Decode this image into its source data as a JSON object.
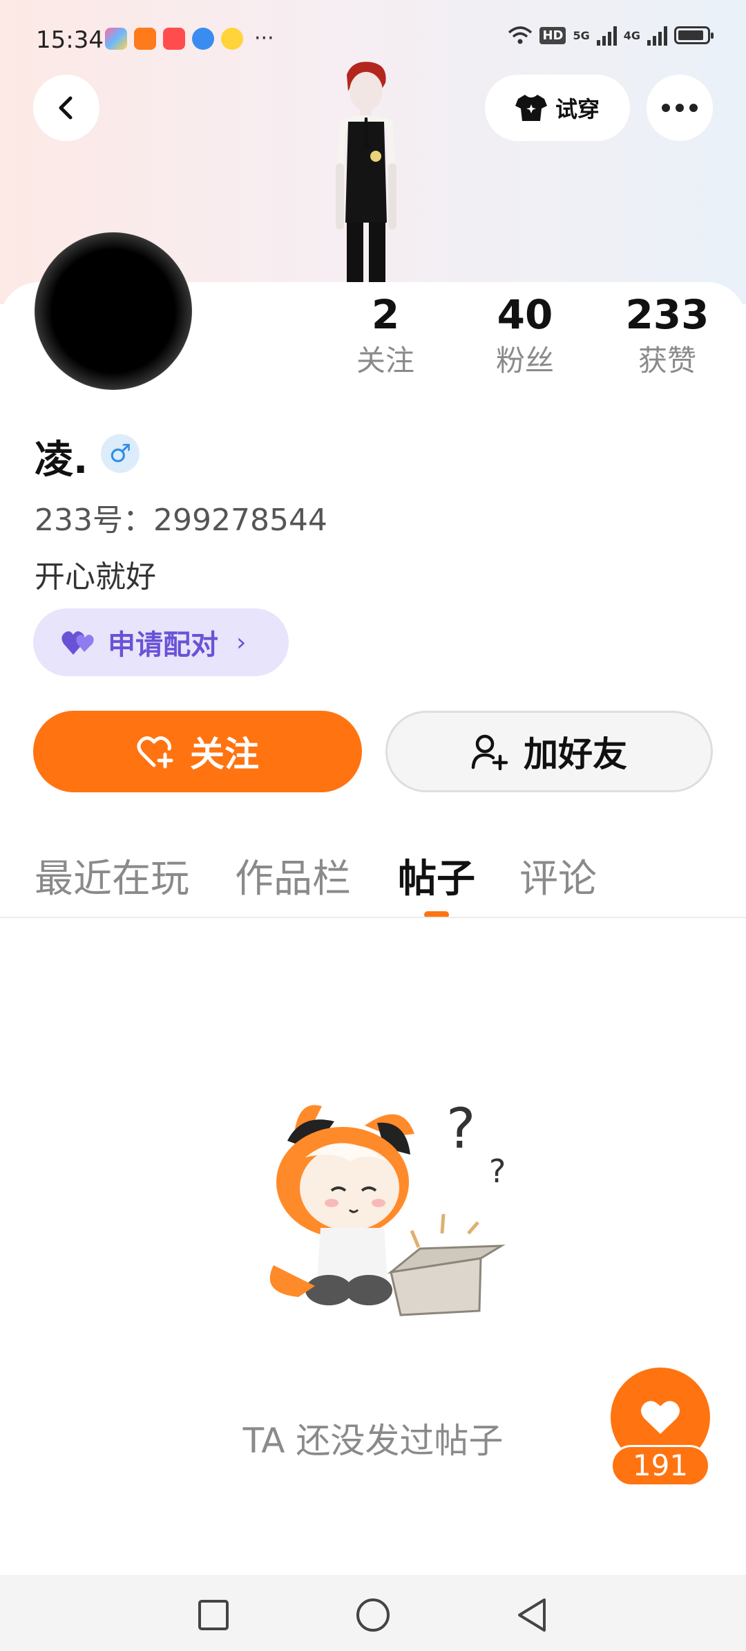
{
  "status_bar": {
    "time": "15:34",
    "more": "···",
    "hd": "HD",
    "net1": "5G",
    "net2": "4G"
  },
  "header": {
    "tryon_label": "试穿"
  },
  "stats": [
    {
      "value": "2",
      "label": "关注"
    },
    {
      "value": "40",
      "label": "粉丝"
    },
    {
      "value": "233",
      "label": "获赞"
    }
  ],
  "profile": {
    "name": "凌.",
    "gender_symbol": "♂",
    "account_id": "233号：299278544",
    "bio": "开心就好",
    "pair_label": "申请配对",
    "pair_chevron": "›"
  },
  "actions": {
    "follow_label": "关注",
    "add_friend_label": "加好友"
  },
  "tabs": [
    {
      "label": "最近在玩"
    },
    {
      "label": "作品栏"
    },
    {
      "label": "帖子",
      "active": true
    },
    {
      "label": "评论"
    }
  ],
  "empty_state": {
    "message": "TA 还没发过帖子"
  },
  "like_fab": {
    "count": "191"
  },
  "colors": {
    "accent": "#ff7311",
    "pair_text": "#6a52d6",
    "pair_bg": "#e8e4fb",
    "gender_blue": "#2f8fe6"
  }
}
